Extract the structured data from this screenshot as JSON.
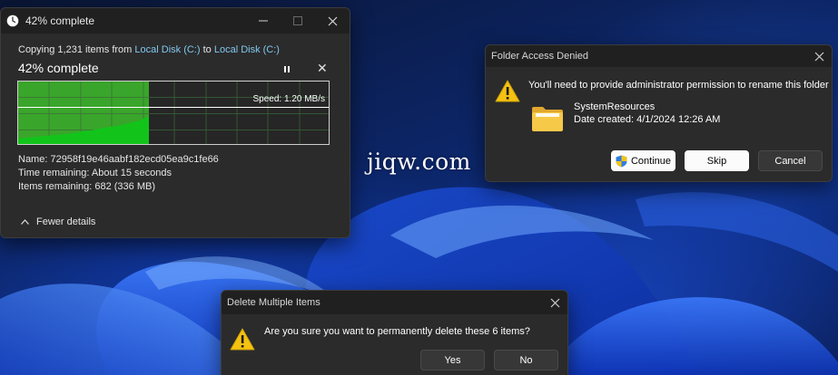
{
  "watermark": "jiqw.com",
  "copy_dialog": {
    "window_title": "42% complete",
    "copy_prefix": "Copying 1,231 items from",
    "source": "Local Disk (C:)",
    "to_word": "to",
    "destination": "Local Disk (C:)",
    "heading": "42% complete",
    "progress_percent": 42,
    "speed": "Speed: 1.20 MB/s",
    "name_line": "Name: 72958f19e46aabf182ecd05ea9c1fe66",
    "time_line": "Time remaining: About 15 seconds",
    "items_line": "Items remaining: 682 (336 MB)",
    "fewer_details": "Fewer details",
    "colors": {
      "progress_fill": "#3aa52b",
      "link": "#7fc8f0"
    }
  },
  "access_dialog": {
    "title": "Folder Access Denied",
    "message": "You'll need to provide administrator permission to rename this folder",
    "folder_name": "SystemResources",
    "date_created": "Date created: 4/1/2024 12:26 AM",
    "buttons": {
      "continue": "Continue",
      "skip": "Skip",
      "cancel": "Cancel"
    }
  },
  "delete_dialog": {
    "title": "Delete Multiple Items",
    "message": "Are you sure you want to permanently delete these 6 items?",
    "buttons": {
      "yes": "Yes",
      "no": "No"
    }
  }
}
